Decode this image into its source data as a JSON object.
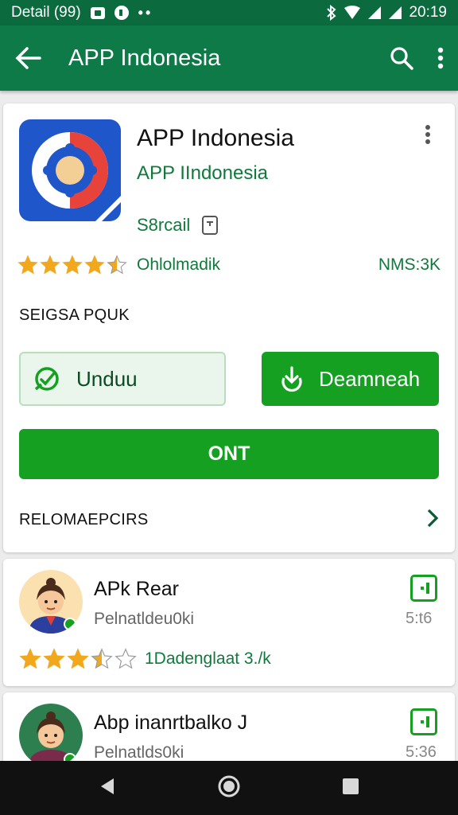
{
  "status_bar": {
    "left_text": "Detail (99)",
    "time": "20:19",
    "icons": [
      "notification-icon",
      "app-icon",
      "more-dots-icon",
      "bluetooth-icon",
      "wifi-icon",
      "signal-icon",
      "signal-icon"
    ]
  },
  "app_bar": {
    "title": "APP Indonesia",
    "icons": [
      "back-arrow-icon",
      "search-icon",
      "more-vert-icon"
    ]
  },
  "app_detail": {
    "name": "APP Indonesia",
    "developer": "APP IIndonesia",
    "size": "S8rcail",
    "rating": 4.5,
    "rating_label": "Ohlolmadik",
    "rating_count": "NMS:3K",
    "section_label": "SEIGSA PQUK",
    "buttons": {
      "outline": "Unduu",
      "solid": "Deamneah",
      "wide": "ONT"
    },
    "recommendations_label": "RELOMAEPCIRS"
  },
  "list_items": [
    {
      "title": "APk Rear",
      "subtitle": "Pelnatldeu0ki",
      "time": "5:t6",
      "rating": 3.5,
      "rating_label": "1Dadenglaat 3./k"
    },
    {
      "title": "Abp inanrtbalko J",
      "subtitle": "Pelnatlds0ki",
      "time": "5:36"
    }
  ],
  "colors": {
    "app_bar": "#0e7a48",
    "status_bar": "#0b6b3f",
    "accent_green": "#15a022",
    "star": "#f2a81d"
  }
}
